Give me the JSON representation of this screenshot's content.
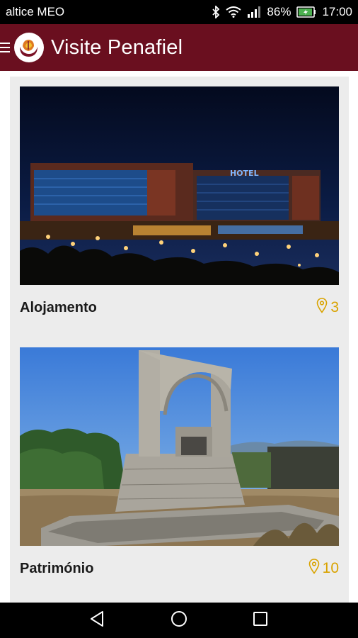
{
  "status_bar": {
    "carrier": "altice MEO",
    "battery": "86%",
    "time": "17:00"
  },
  "app_bar": {
    "title": "Visite Penafiel"
  },
  "categories": [
    {
      "title": "Alojamento",
      "count": "3",
      "image": "hotel-at-night"
    },
    {
      "title": "Património",
      "count": "10",
      "image": "stone-arch-monument"
    }
  ],
  "colors": {
    "app_bar": "#6a0f1f",
    "accent": "#d9a300",
    "card_bg": "#ececec"
  }
}
